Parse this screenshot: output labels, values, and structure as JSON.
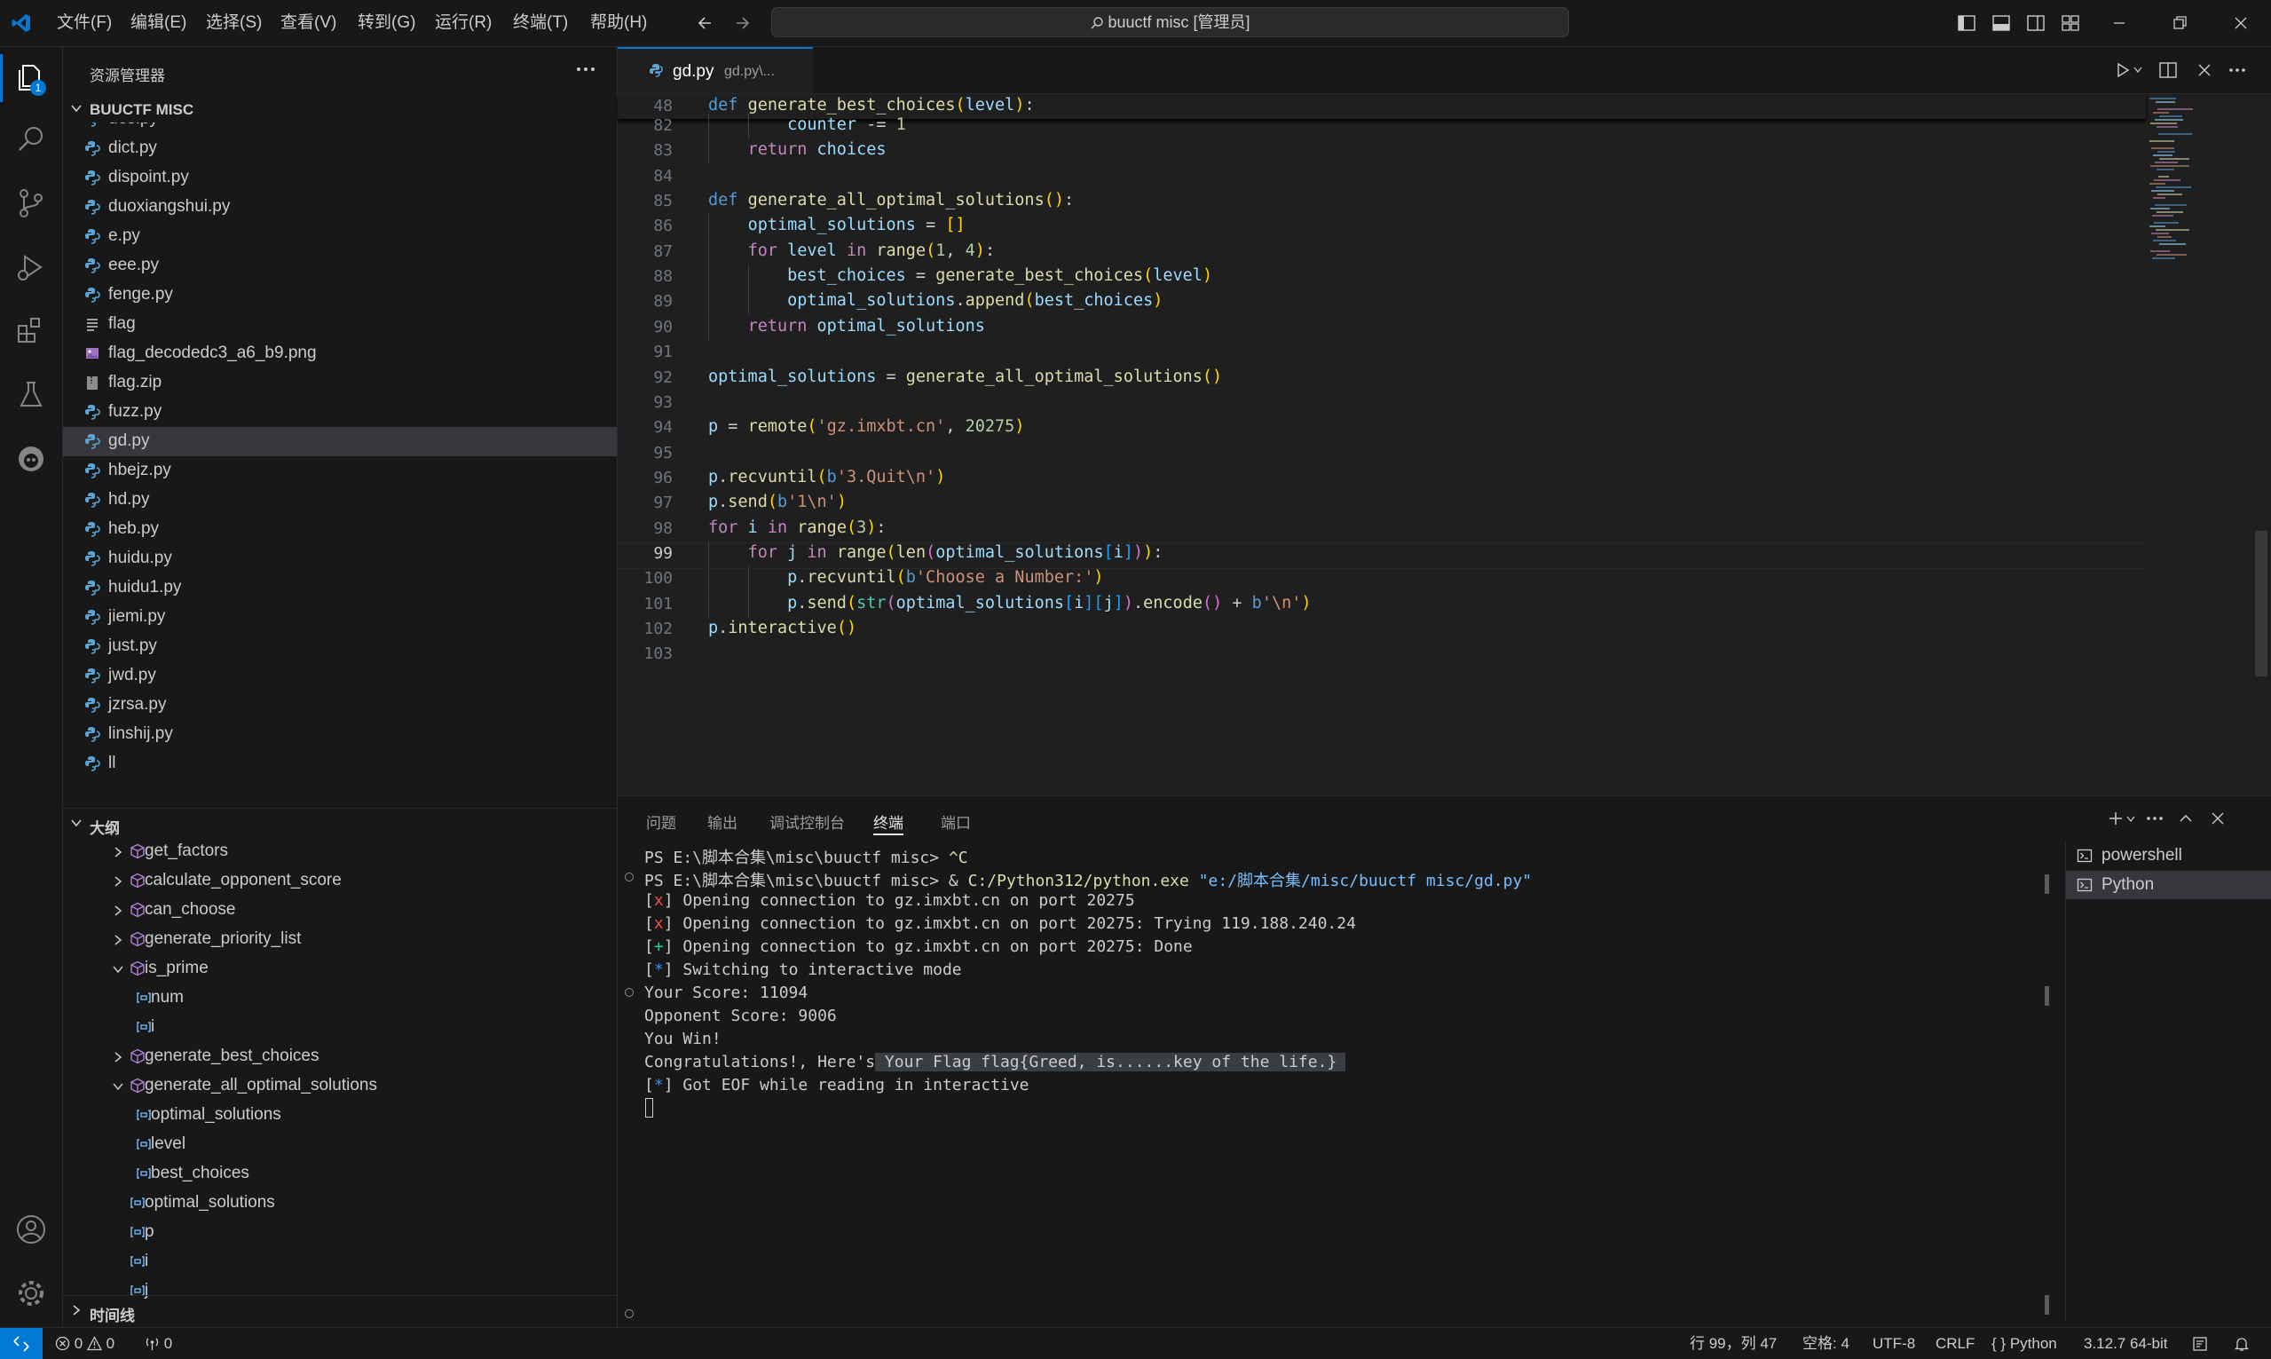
{
  "menu": [
    "文件(F)",
    "编辑(E)",
    "选择(S)",
    "查看(V)",
    "转到(G)",
    "运行(R)",
    "终端(T)",
    "帮助(H)"
  ],
  "search": {
    "text": "buuctf misc [管理员]"
  },
  "explorer": {
    "title": "资源管理器",
    "badge": "1",
    "folder": "BUUCTF MISC",
    "files": [
      {
        "name": "des.py",
        "type": "py"
      },
      {
        "name": "dict.py",
        "type": "py"
      },
      {
        "name": "dispoint.py",
        "type": "py"
      },
      {
        "name": "duoxiangshui.py",
        "type": "py"
      },
      {
        "name": "e.py",
        "type": "py"
      },
      {
        "name": "eee.py",
        "type": "py"
      },
      {
        "name": "fenge.py",
        "type": "py"
      },
      {
        "name": "flag",
        "type": "txt"
      },
      {
        "name": "flag_decodedc3_a6_b9.png",
        "type": "img"
      },
      {
        "name": "flag.zip",
        "type": "zip"
      },
      {
        "name": "fuzz.py",
        "type": "py"
      },
      {
        "name": "gd.py",
        "type": "py"
      },
      {
        "name": "hbejz.py",
        "type": "py"
      },
      {
        "name": "hd.py",
        "type": "py"
      },
      {
        "name": "heb.py",
        "type": "py"
      },
      {
        "name": "huidu.py",
        "type": "py"
      },
      {
        "name": "huidu1.py",
        "type": "py"
      },
      {
        "name": "jiemi.py",
        "type": "py"
      },
      {
        "name": "just.py",
        "type": "py"
      },
      {
        "name": "jwd.py",
        "type": "py"
      },
      {
        "name": "jzrsa.py",
        "type": "py"
      },
      {
        "name": "linshij.py",
        "type": "py"
      },
      {
        "name": "ll",
        "type": "py"
      }
    ]
  },
  "outline": {
    "title": "大纲",
    "items": [
      {
        "name": "get_factors",
        "kind": "fn",
        "indent": 0,
        "chev": "right"
      },
      {
        "name": "calculate_opponent_score",
        "kind": "fn",
        "indent": 0,
        "chev": "right"
      },
      {
        "name": "can_choose",
        "kind": "fn",
        "indent": 0,
        "chev": "right"
      },
      {
        "name": "generate_priority_list",
        "kind": "fn",
        "indent": 0,
        "chev": "right"
      },
      {
        "name": "is_prime",
        "kind": "fn",
        "indent": 0,
        "chev": "down"
      },
      {
        "name": "num",
        "kind": "var",
        "indent": 1,
        "chev": ""
      },
      {
        "name": "i",
        "kind": "var",
        "indent": 1,
        "chev": ""
      },
      {
        "name": "generate_best_choices",
        "kind": "fn",
        "indent": 0,
        "chev": "right"
      },
      {
        "name": "generate_all_optimal_solutions",
        "kind": "fn",
        "indent": 0,
        "chev": "down"
      },
      {
        "name": "optimal_solutions",
        "kind": "var",
        "indent": 1,
        "chev": ""
      },
      {
        "name": "level",
        "kind": "var",
        "indent": 1,
        "chev": ""
      },
      {
        "name": "best_choices",
        "kind": "var",
        "indent": 1,
        "chev": ""
      },
      {
        "name": "optimal_solutions",
        "kind": "var",
        "indent": -1,
        "chev": ""
      },
      {
        "name": "p",
        "kind": "var",
        "indent": -1,
        "chev": ""
      },
      {
        "name": "i",
        "kind": "var",
        "indent": -1,
        "chev": ""
      },
      {
        "name": "j",
        "kind": "var",
        "indent": -1,
        "chev": ""
      }
    ]
  },
  "timeline": {
    "title": "时间线"
  },
  "tab": {
    "name": "gd.py",
    "path": "gd.py\\..."
  },
  "sticky": {
    "num": "48",
    "code": "def generate_best_choices(level):"
  },
  "code": [
    {
      "num": "82",
      "html": "        <span class='vr'>counter</span> <span class='pl'>-=</span> <span class='nu'>1</span>"
    },
    {
      "num": "83",
      "html": "    <span class='kw'>return</span> <span class='vr'>choices</span>"
    },
    {
      "num": "84",
      "html": ""
    },
    {
      "num": "85",
      "html": "<span class='df'>def</span> <span class='fn'>generate_all_optimal_solutions</span><span class='br1'>()</span><span class='pl'>:</span>"
    },
    {
      "num": "86",
      "html": "    <span class='vr'>optimal_solutions</span> <span class='pl'>=</span> <span class='br1'>[]</span>"
    },
    {
      "num": "87",
      "html": "    <span class='kw'>for</span> <span class='vr'>level</span> <span class='kw'>in</span> <span class='fn'>range</span><span class='br1'>(</span><span class='nu'>1</span><span class='pl'>,</span> <span class='nu'>4</span><span class='br1'>)</span><span class='pl'>:</span>"
    },
    {
      "num": "88",
      "html": "        <span class='vr'>best_choices</span> <span class='pl'>=</span> <span class='fn'>generate_best_choices</span><span class='br1'>(</span><span class='vr'>level</span><span class='br1'>)</span>"
    },
    {
      "num": "89",
      "html": "        <span class='vr'>optimal_solutions</span><span class='pl'>.</span><span class='fn'>append</span><span class='br1'>(</span><span class='vr'>best_choices</span><span class='br1'>)</span>"
    },
    {
      "num": "90",
      "html": "    <span class='kw'>return</span> <span class='vr'>optimal_solutions</span>"
    },
    {
      "num": "91",
      "html": ""
    },
    {
      "num": "92",
      "html": "<span class='vr'>optimal_solutions</span> <span class='pl'>=</span> <span class='fn'>generate_all_optimal_solutions</span><span class='br1'>()</span>"
    },
    {
      "num": "93",
      "html": ""
    },
    {
      "num": "94",
      "html": "<span class='vr'>p</span> <span class='pl'>=</span> <span class='fn'>remote</span><span class='br1'>(</span><span class='st'>'gz.imxbt.cn'</span><span class='pl'>,</span> <span class='nu'>20275</span><span class='br1'>)</span>"
    },
    {
      "num": "95",
      "html": ""
    },
    {
      "num": "96",
      "html": "<span class='vr'>p</span><span class='pl'>.</span><span class='fn'>recvuntil</span><span class='br1'>(</span><span class='df'>b</span><span class='st'>'3.Quit\\n'</span><span class='br1'>)</span>"
    },
    {
      "num": "97",
      "html": "<span class='vr'>p</span><span class='pl'>.</span><span class='fn'>send</span><span class='br1'>(</span><span class='df'>b</span><span class='st'>'1\\n'</span><span class='br1'>)</span>"
    },
    {
      "num": "98",
      "html": "<span class='kw'>for</span> <span class='vr'>i</span> <span class='kw'>in</span> <span class='fn'>range</span><span class='br1'>(</span><span class='nu'>3</span><span class='br1'>)</span><span class='pl'>:</span>"
    },
    {
      "num": "99",
      "html": "    <span class='kw'>for</span> <span class='vr'>j</span> <span class='kw'>in</span> <span class='fn'>range</span><span class='br1'>(</span><span class='fn'>len</span><span class='br2'>(</span><span class='vr'>optimal_solutions</span><span class='br3'>[</span><span class='vr'>i</span><span class='br3'>]</span><span class='br2'>)</span><span class='br1'>)</span><span class='pl'>:</span>"
    },
    {
      "num": "100",
      "html": "        <span class='vr'>p</span><span class='pl'>.</span><span class='fn'>recvuntil</span><span class='br1'>(</span><span class='df'>b</span><span class='st'>'Choose a Number:'</span><span class='br1'>)</span>"
    },
    {
      "num": "101",
      "html": "        <span class='vr'>p</span><span class='pl'>.</span><span class='fn'>send</span><span class='br1'>(</span><span class='bl'>str</span><span class='br2'>(</span><span class='vr'>optimal_solutions</span><span class='br3'>[</span><span class='vr'>i</span><span class='br3'>][</span><span class='vr'>j</span><span class='br3'>]</span><span class='br2'>)</span><span class='pl'>.</span><span class='fn'>encode</span><span class='br2'>()</span> <span class='pl'>+</span> <span class='df'>b</span><span class='st'>'\\n'</span><span class='br1'>)</span>"
    },
    {
      "num": "102",
      "html": "<span class='vr'>p</span><span class='pl'>.</span><span class='fn'>interactive</span><span class='br1'>()</span>"
    },
    {
      "num": "103",
      "html": ""
    }
  ],
  "panel": {
    "tabs": [
      "问题",
      "输出",
      "调试控制台",
      "终端",
      "端口"
    ],
    "active_tab": "终端",
    "terminal": [
      "PS E:\\脚本合集\\misc\\buuctf misc> ^C",
      "PS E:\\脚本合集\\misc\\buuctf misc> & C:/Python312/python.exe \"e:/脚本合集/misc/buuctf misc/gd.py\"",
      "[x] Opening connection to gz.imxbt.cn on port 20275",
      "[x] Opening connection to gz.imxbt.cn on port 20275: Trying 119.188.240.24",
      "[+] Opening connection to gz.imxbt.cn on port 20275: Done",
      "[*] Switching to interactive mode",
      "Your Score: 11094",
      "Opponent Score: 9006",
      "You Win!",
      "Congratulations!, Here's Your Flag flag{Greed, is......key of the life.}",
      "[*] Got EOF while reading in interactive"
    ],
    "sessions": [
      "powershell",
      "Python"
    ]
  },
  "status": {
    "errors": "0",
    "warnings": "0",
    "ports": "0",
    "position": "行 99，列 47",
    "spaces": "空格: 4",
    "encoding": "UTF-8",
    "eol": "CRLF",
    "language": "Python",
    "interpreter": "3.12.7 64-bit"
  },
  "colors": {
    "accent": "#0078d4",
    "selection": "#37373d"
  }
}
